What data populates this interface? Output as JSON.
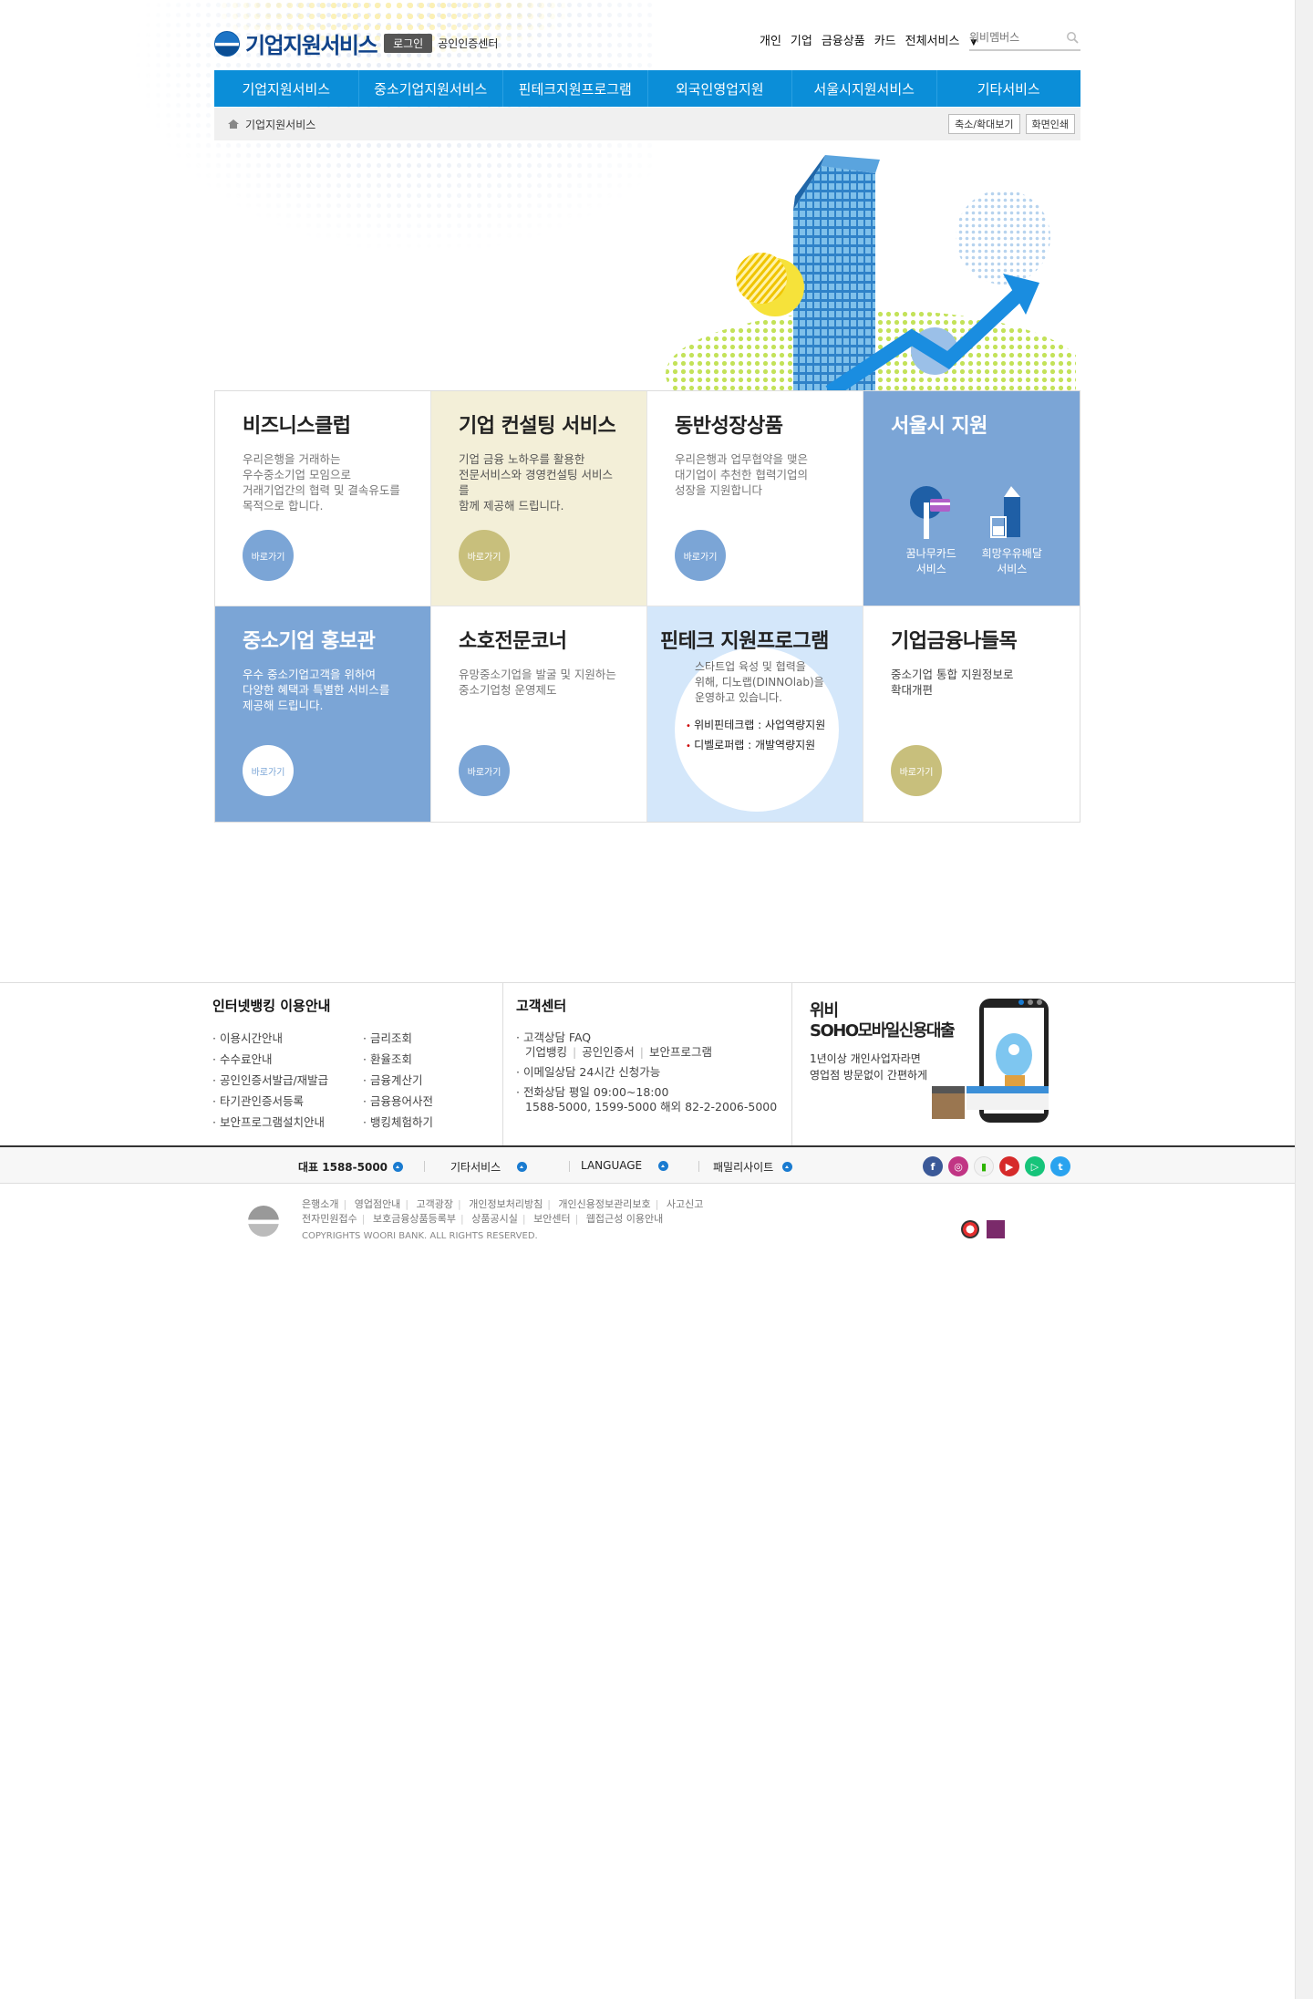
{
  "header": {
    "logo_text": "기업지원서비스",
    "login_label": "로그인",
    "cert_center_label": "공인인증센터",
    "gnb": [
      "개인",
      "기업",
      "금융상품",
      "카드",
      "전체서비스"
    ],
    "search_placeholder": "위비멤버스"
  },
  "main_nav": [
    "기업지원서비스",
    "중소기업지원서비스",
    "핀테크지원프로그램",
    "외국인영업지원",
    "서울시지원서비스",
    "기타서비스"
  ],
  "breadcrumb": {
    "current": "기업지원서비스",
    "tools": [
      "축소/확대보기",
      "화면인쇄"
    ]
  },
  "cards": {
    "business_club": {
      "title": "비즈니스클럽",
      "desc": "우리은행을 거래하는\n우수중소기업 모임으로\n거래기업간의 협력 및 결속유도를\n목적으로 합니다.",
      "button": "바로가기"
    },
    "consulting": {
      "title": "기업 컨설팅 서비스",
      "desc": "기업 금융 노하우를 활용한\n전문서비스와 경영컨설팅 서비스를\n함께 제공해 드립니다.",
      "button": "바로가기"
    },
    "growth": {
      "title": "동반성장상품",
      "desc": "우리은행과 업무협약을 맺은\n대기업이 추천한 협력기업의\n성장을 지원합니다",
      "button": "바로가기"
    },
    "seoul": {
      "title": "서울시 지원",
      "items": [
        "꿈나무카드\n서비스",
        "희망우유배달\n서비스"
      ]
    },
    "promo": {
      "title": "중소기업 홍보관",
      "desc": "우수 중소기업고객을 위하여\n다양한 혜택과 특별한 서비스를\n제공해 드립니다.",
      "button": "바로가기"
    },
    "soho": {
      "title": "소호전문코너",
      "desc": "유망중소기업을 발굴 및 지원하는\n중소기업청 운영제도",
      "button": "바로가기"
    },
    "fintech": {
      "title": "핀테크 지원프로그램",
      "desc": "스타트업 육성 및 협력을\n위해, 디노랩(DINNOlab)을\n운영하고 있습니다.",
      "list": [
        "위비핀테크랩 : 사업역량지원",
        "디벨로퍼랩 : 개발역량지원"
      ]
    },
    "finance_outing": {
      "title": "기업금융나들목",
      "desc": "중소기업 통합 지원정보로\n확대개편",
      "button": "바로가기"
    }
  },
  "footer": {
    "banking_title": "인터넷뱅킹 이용안내",
    "banking_col1": [
      "이용시간안내",
      "수수료안내",
      "공인인증서발급/재발급",
      "타기관인증서등록",
      "보안프로그램설치안내"
    ],
    "banking_col2": [
      "금리조회",
      "환율조회",
      "금융계산기",
      "금융용어사전",
      "뱅킹체험하기"
    ],
    "cs_title": "고객센터",
    "cs_faq": "고객상담 FAQ",
    "cs_faq_links": [
      "기업뱅킹",
      "공인인증서",
      "보안프로그램"
    ],
    "cs_email": "이메일상담 24시간 신청가능",
    "cs_phone": "전화상담 평일 09:00~18:00",
    "cs_numbers": "1588-5000, 1599-5000 해외 82-2-2006-5000",
    "promo_title1": "위비",
    "promo_title2": "SOHO모바일신용대출",
    "promo_desc": "1년이상 개인사업자라면\n영업점 방문없이 간편하게",
    "bar_items": [
      "대표 1588-5000",
      "기타서비스",
      "LANGUAGE",
      "패밀리사이트"
    ],
    "links_row1": [
      "은행소개",
      "영업점안내",
      "고객광장",
      "개인정보처리방침",
      "개인신용정보관리보호",
      "사고신고"
    ],
    "links_row2": [
      "전자민원접수",
      "보호금융상품등록부",
      "상품공시실",
      "보안센터",
      "웹접근성 이용안내"
    ],
    "copyright": "COPYRIGHTS WOORI BANK. ALL RIGHTS RESERVED."
  },
  "colors": {
    "nav_blue": "#0b8ed8",
    "card_blue": "#7ba5d6",
    "beige": "#f3efd8",
    "olive": "#c8bf7c"
  }
}
